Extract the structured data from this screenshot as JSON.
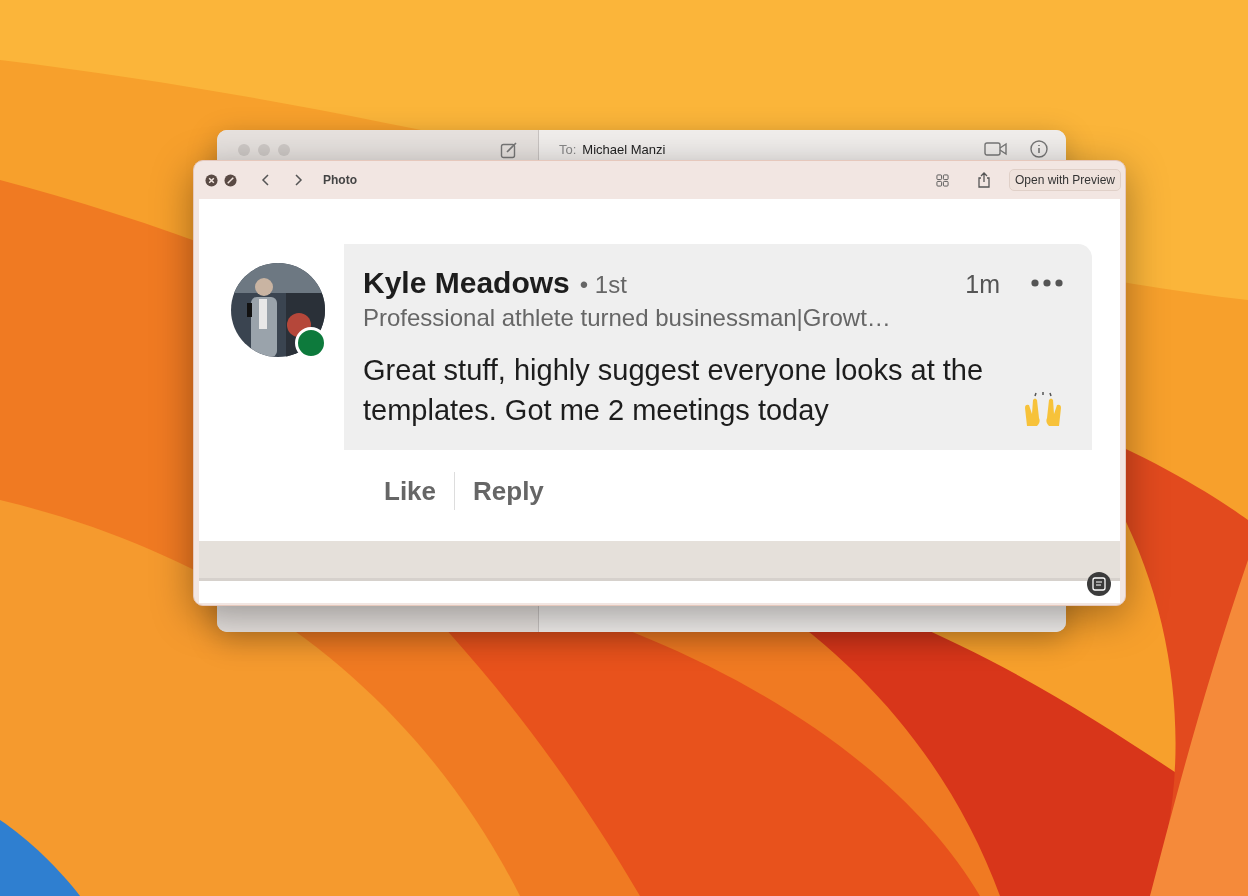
{
  "back_window": {
    "recipient_label": "To:",
    "recipient": "Michael Manzi"
  },
  "quick_look": {
    "title": "Photo",
    "open_button": "Open with Preview"
  },
  "comment": {
    "author": "Kyle Meadows",
    "degree": "• 1st",
    "time": "1m",
    "online": true,
    "headline": "Professional athlete turned businessman|Growt…",
    "text": "Great stuff, highly suggest everyone looks at the templates. Got me 2 meetings today",
    "actions": [
      "Like",
      "Reply"
    ]
  }
}
